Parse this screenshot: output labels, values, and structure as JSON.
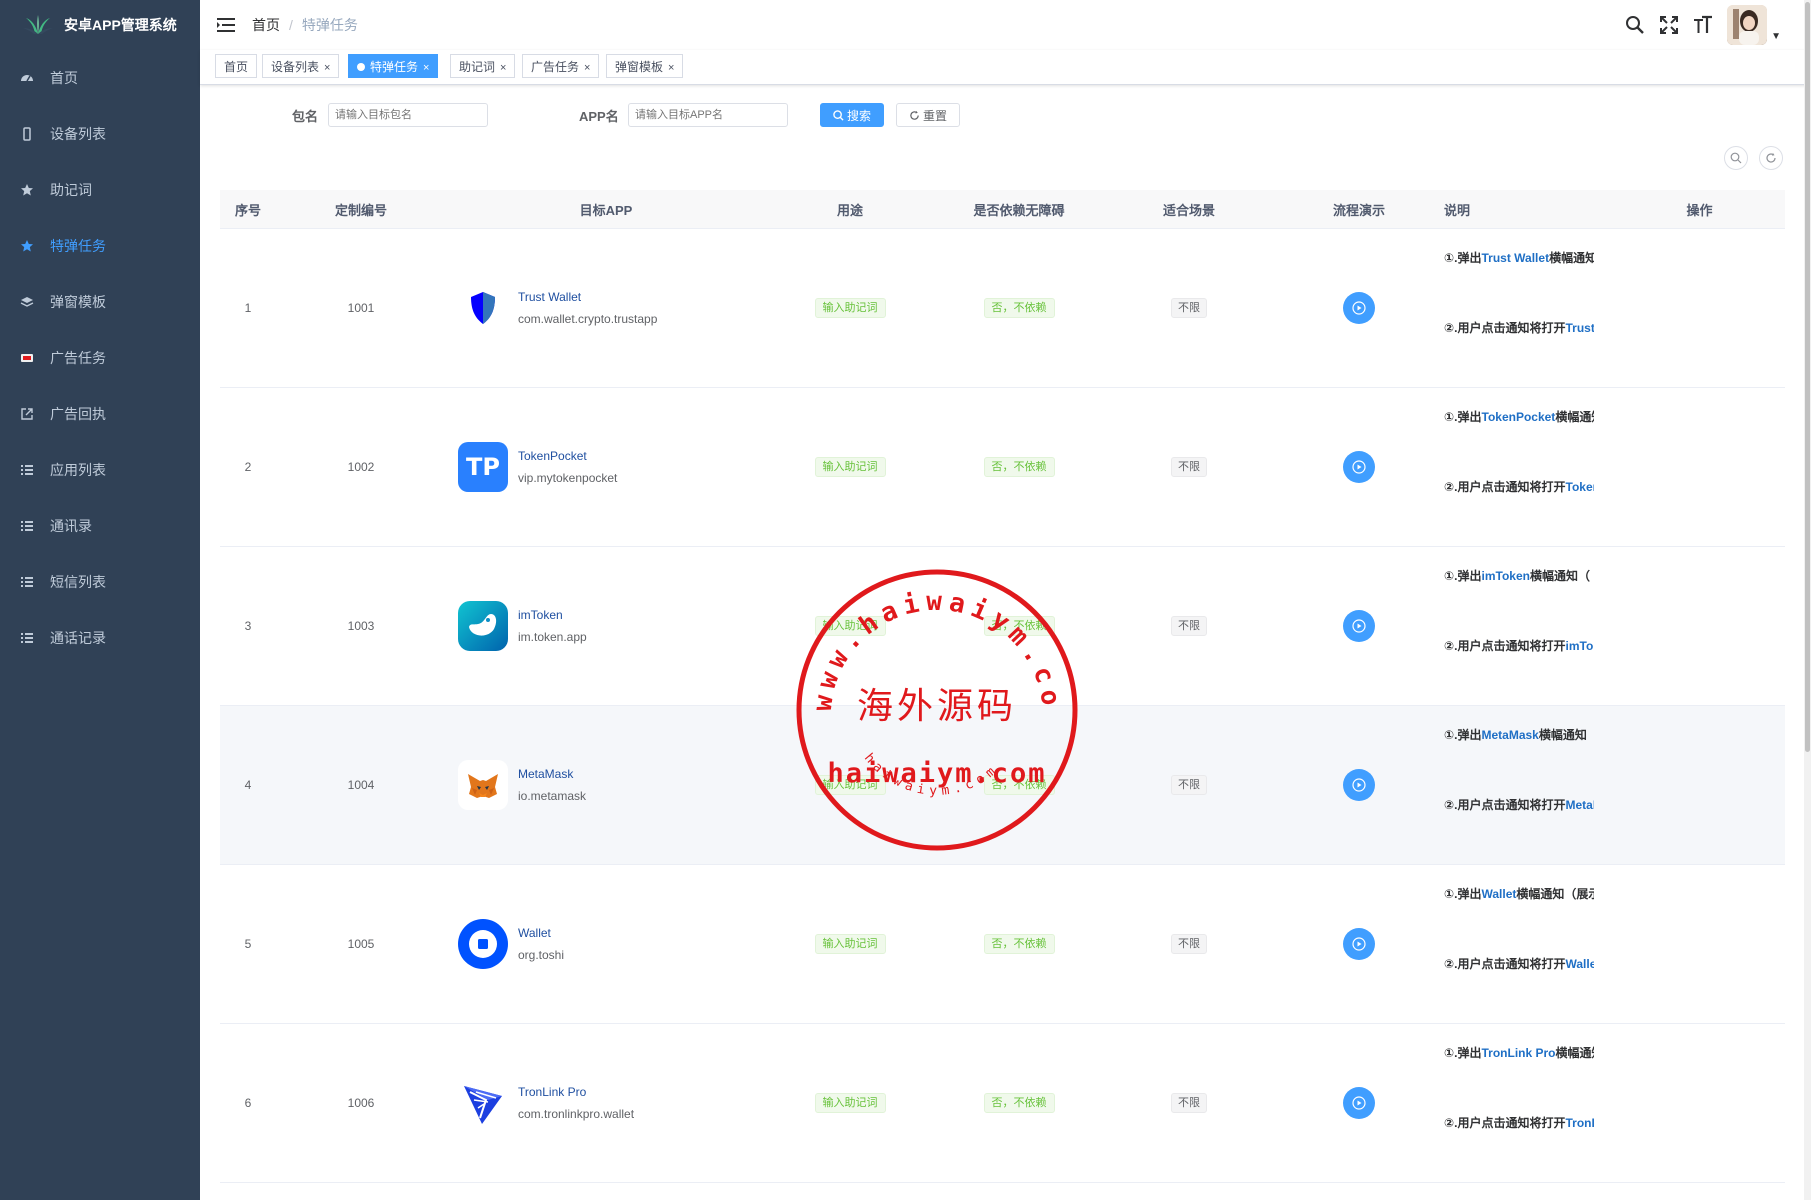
{
  "app": {
    "title": "安卓APP管理系统"
  },
  "sidebar": {
    "items": [
      {
        "label": "首页",
        "icon": "dashboard-icon"
      },
      {
        "label": "设备列表",
        "icon": "phone-icon"
      },
      {
        "label": "助记词",
        "icon": "star-icon"
      },
      {
        "label": "特弹任务",
        "icon": "star-icon",
        "active": true
      },
      {
        "label": "弹窗模板",
        "icon": "layers-icon"
      },
      {
        "label": "广告任务",
        "icon": "ad-icon"
      },
      {
        "label": "广告回执",
        "icon": "external-link-icon"
      },
      {
        "label": "应用列表",
        "icon": "list-icon"
      },
      {
        "label": "通讯录",
        "icon": "list-icon"
      },
      {
        "label": "短信列表",
        "icon": "list-icon"
      },
      {
        "label": "通话记录",
        "icon": "list-icon"
      }
    ]
  },
  "breadcrumb": {
    "home": "首页",
    "sep": "/",
    "current": "特弹任务"
  },
  "tabs": [
    {
      "label": "首页",
      "closable": false
    },
    {
      "label": "设备列表",
      "closable": true
    },
    {
      "label": "特弹任务",
      "closable": true,
      "active": true
    },
    {
      "label": "助记词",
      "closable": true
    },
    {
      "label": "广告任务",
      "closable": true
    },
    {
      "label": "弹窗模板",
      "closable": true
    }
  ],
  "search": {
    "pkg_label": "包名",
    "pkg_placeholder": "请输入目标包名",
    "app_label": "APP名",
    "app_placeholder": "请输入目标APP名",
    "search_btn": "搜索",
    "reset_btn": "重置"
  },
  "table": {
    "headers": [
      "序号",
      "定制编号",
      "目标APP",
      "用途",
      "是否依赖无障碍",
      "适合场景",
      "流程演示",
      "说明",
      "操作"
    ],
    "rows": [
      {
        "index": "1",
        "code": "1001",
        "app_name": "Trust Wallet",
        "pkg": "com.wallet.crypto.trustapp",
        "purpose": "输入助记词",
        "depends": "否，不依赖",
        "scene": "不限",
        "desc1_pre": "①.弹出",
        "desc1_hl": "Trust Wallet",
        "desc1_post": "横幅通知",
        "desc2_pre": "②.用户点击通知将打开",
        "desc2_hl": "Trust Wallet"
      },
      {
        "index": "2",
        "code": "1002",
        "app_name": "TokenPocket",
        "pkg": "vip.mytokenpocket",
        "purpose": "输入助记词",
        "depends": "否，不依赖",
        "scene": "不限",
        "desc1_pre": "①.弹出",
        "desc1_hl": "TokenPocket",
        "desc1_post": "横幅通知",
        "desc2_pre": "②.用户点击通知将打开",
        "desc2_hl": "TokenPocket"
      },
      {
        "index": "3",
        "code": "1003",
        "app_name": "imToken",
        "pkg": "im.token.app",
        "purpose": "输入助记词",
        "depends": "否，不依赖",
        "scene": "不限",
        "desc1_pre": "①.弹出",
        "desc1_hl": "imToken",
        "desc1_post": "横幅通知（",
        "desc2_pre": "②.用户点击通知将打开",
        "desc2_hl": "imToken"
      },
      {
        "index": "4",
        "code": "1004",
        "app_name": "MetaMask",
        "pkg": "io.metamask",
        "purpose": "输入助记词",
        "depends": "否，不依赖",
        "scene": "不限",
        "desc1_pre": "①.弹出",
        "desc1_hl": "MetaMask",
        "desc1_post": "横幅通知",
        "desc2_pre": "②.用户点击通知将打开",
        "desc2_hl": "MetaMask"
      },
      {
        "index": "5",
        "code": "1005",
        "app_name": "Wallet",
        "pkg": "org.toshi",
        "purpose": "输入助记词",
        "depends": "否，不依赖",
        "scene": "不限",
        "desc1_pre": "①.弹出",
        "desc1_hl": "Wallet",
        "desc1_post": "横幅通知（展示",
        "desc2_pre": "②.用户点击通知将打开",
        "desc2_hl": "Wallet"
      },
      {
        "index": "6",
        "code": "1006",
        "app_name": "TronLink Pro",
        "pkg": "com.tronlinkpro.wallet",
        "purpose": "输入助记词",
        "depends": "否，不依赖",
        "scene": "不限",
        "desc1_pre": "①.弹出",
        "desc1_hl": "TronLink Pro",
        "desc1_post": "横幅通知",
        "desc2_pre": "②.用户点击通知将打开",
        "desc2_hl": "TronLink Pro"
      }
    ]
  },
  "watermark": {
    "center": "海外源码",
    "domain": "haiwaiym.com",
    "ring_top": "www.haiwaiym.com",
    "ring_bottom": "haiwaiym.com",
    "color": "#e0191c"
  },
  "colors": {
    "sidebar_bg": "#304156",
    "primary": "#409eff",
    "success": "#67c23a"
  }
}
